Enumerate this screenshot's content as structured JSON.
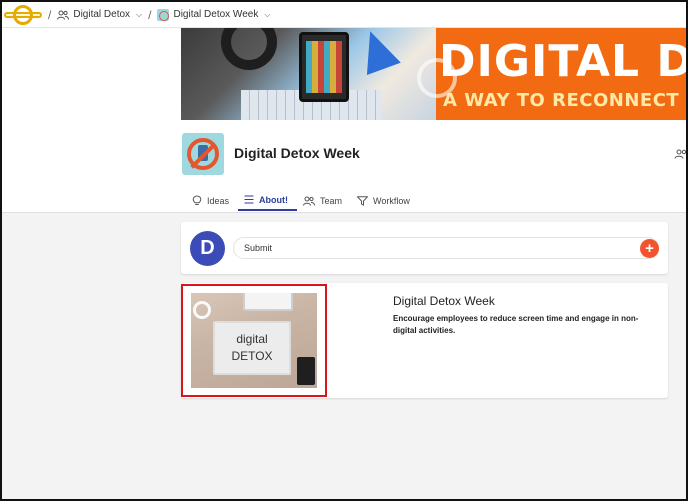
{
  "breadcrumb": {
    "separator": "/",
    "items": [
      {
        "label": "Digital Detox",
        "icon": "people-icon"
      },
      {
        "label": "Digital Detox Week",
        "icon": "project-thumbnail"
      }
    ]
  },
  "banner": {
    "line1": "DIGITAL D",
    "line2": "A WAY TO RECONNECT W"
  },
  "project": {
    "title": "Digital Detox Week"
  },
  "tabs": [
    {
      "label": "Ideas",
      "icon": "lightbulb-icon",
      "active": false
    },
    {
      "label": "About!",
      "icon": "list-icon",
      "active": true
    },
    {
      "label": "Team",
      "icon": "people-icon",
      "active": false
    },
    {
      "label": "Workflow",
      "icon": "funnel-icon",
      "active": false
    }
  ],
  "submit": {
    "avatar_letter": "D",
    "placeholder": "Submit",
    "button": "+"
  },
  "idea": {
    "title": "Digital Detox Week",
    "description": "Encourage employees to reduce screen time and engage in non-digital activities.",
    "image_text_line1": "digital",
    "image_text_line2": "DETOX"
  },
  "colors": {
    "accent": "#2c3e9e",
    "avatar": "#3b4cb8",
    "plus_button": "#f2542d",
    "banner": "#f26b12",
    "highlight": "#d9141a"
  }
}
